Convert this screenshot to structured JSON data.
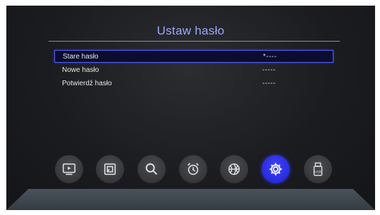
{
  "title": "Ustaw hasło",
  "rows": [
    {
      "label": "Stare hasło",
      "value": "*----",
      "selected": true
    },
    {
      "label": "Nowe hasło",
      "value": "-----",
      "selected": false
    },
    {
      "label": "Potwierdź hasło",
      "value": "-----",
      "selected": false
    }
  ],
  "menu_icons": [
    {
      "name": "tv-icon",
      "active": false
    },
    {
      "name": "picture-icon",
      "active": false
    },
    {
      "name": "search-icon",
      "active": false
    },
    {
      "name": "alarm-clock-icon",
      "active": false
    },
    {
      "name": "basketball-icon",
      "active": false
    },
    {
      "name": "settings-gear-icon",
      "active": true
    },
    {
      "name": "usb-icon",
      "active": false
    }
  ],
  "colors": {
    "accent": "#3e43ff",
    "title": "#9ea7ff",
    "selection_border": "#4f5dff"
  }
}
